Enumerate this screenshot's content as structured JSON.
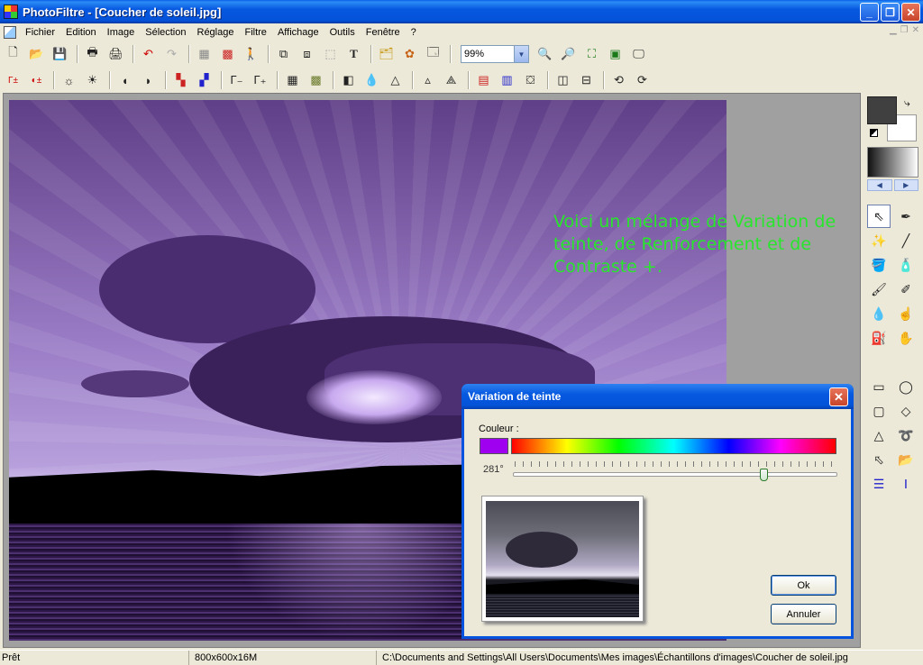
{
  "window": {
    "title": "PhotoFiltre - [Coucher de soleil.jpg]"
  },
  "menu": [
    "Fichier",
    "Edition",
    "Image",
    "Sélection",
    "Réglage",
    "Filtre",
    "Affichage",
    "Outils",
    "Fenêtre",
    "?"
  ],
  "toolbar": {
    "zoom": "99%"
  },
  "canvas": {
    "overlay_text": "Voici un mélange de Variation de teinte, de Renforcement et de Contraste +."
  },
  "dialog": {
    "title": "Variation de teinte",
    "color_label": "Couleur :",
    "hue_value": "281°",
    "hue_fraction": 0.78,
    "swatch_color": "#a000f0",
    "ok_label": "Ok",
    "cancel_label": "Annuler"
  },
  "status": {
    "state": "Prêt",
    "dimensions": "800x600x16M",
    "path": "C:\\Documents and Settings\\All Users\\Documents\\Mes images\\Échantillons d'images\\Coucher de soleil.jpg"
  },
  "colors": {
    "accent": "#0653dd",
    "overlay_text": "#27e62b"
  }
}
